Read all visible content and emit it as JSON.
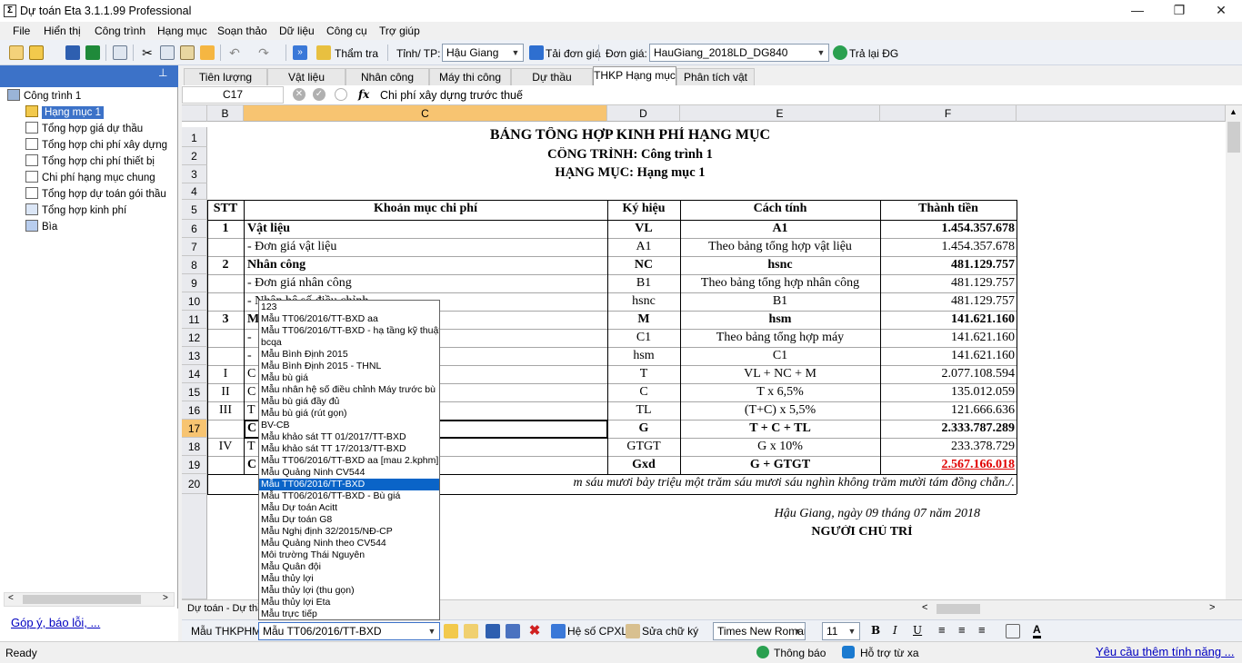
{
  "window": {
    "title": "Dự toán Eta 3.1.1.99 Professional",
    "app_icon": "sigma-icon"
  },
  "menu": [
    "File",
    "Hiển thị",
    "Công trình",
    "Hạng mục",
    "Soạn thảo",
    "Dữ liệu",
    "Công cụ",
    "Trợ giúp"
  ],
  "toolbar": {
    "tham_tra": "Thẩm tra",
    "tinh_tp_label": "Tỉnh/ TP:",
    "tinh_tp_value": "Hậu Giang",
    "tai_don_gia": "Tải đơn giá",
    "don_gia_label": "Đơn giá:",
    "don_gia_value": "HauGiang_2018LD_DG840",
    "tra_lai_dg": "Trả lại ĐG"
  },
  "tree": {
    "root": "Công trình 1",
    "items": [
      "Hạng mục 1",
      "Tổng hợp giá dự thầu",
      "Tổng hợp chi phí xây dựng",
      "Tổng hợp chi phí thiết bị",
      "Chi phí hạng mục chung",
      "Tổng hợp dự toán gói thầu",
      "Tổng hợp kinh phí",
      "Bìa"
    ],
    "feedback": "Góp ý, báo lỗi, ..."
  },
  "tabs": [
    "Tiên lượng",
    "Vật liệu",
    "Nhân công",
    "Máy thi công",
    "Dự thầu",
    "THKP Hạng mục",
    "Phân tích vật tư"
  ],
  "active_tab": "THKP Hạng mục",
  "formula": {
    "cell_ref": "C17",
    "fx": "fx",
    "content": "Chi phí xây dựng trước thuế"
  },
  "columns": [
    "B",
    "C",
    "D",
    "E",
    "F"
  ],
  "rows": [
    "1",
    "2",
    "3",
    "4",
    "5",
    "6",
    "7",
    "8",
    "9",
    "10",
    "11",
    "12",
    "13",
    "14",
    "15",
    "16",
    "17",
    "18",
    "19",
    "20"
  ],
  "sheet": {
    "title": "BẢNG TỔNG HỢP KINH PHÍ HẠNG MỤC",
    "line2": "CÔNG TRÌNH: Công trình 1",
    "line3": "HẠNG MỤC: Hạng mục 1",
    "headers": [
      "STT",
      "Khoản mục chi phí",
      "Ký hiệu",
      "Cách tính",
      "Thành tiền"
    ],
    "body": [
      {
        "stt": "1",
        "name": "Vật liệu",
        "sym": "VL",
        "calc": "A1",
        "amt": "1.454.357.678",
        "bold": true
      },
      {
        "stt": "",
        "name": "- Đơn giá vật liệu",
        "sym": "A1",
        "calc": "Theo bảng tổng hợp vật liệu",
        "amt": "1.454.357.678",
        "bold": false
      },
      {
        "stt": "2",
        "name": "Nhân công",
        "sym": "NC",
        "calc": "hsnc",
        "amt": "481.129.757",
        "bold": true
      },
      {
        "stt": "",
        "name": "- Đơn giá nhân công",
        "sym": "B1",
        "calc": "Theo bảng tổng hợp nhân công",
        "amt": "481.129.757",
        "bold": false
      },
      {
        "stt": "",
        "name": "- Nhân hệ số điều chỉnh",
        "sym": "hsnc",
        "calc": "B1",
        "amt": "481.129.757",
        "bold": false
      },
      {
        "stt": "3",
        "name": "M",
        "sym": "M",
        "calc": "hsm",
        "amt": "141.621.160",
        "bold": true
      },
      {
        "stt": "",
        "name": "-",
        "sym": "C1",
        "calc": "Theo bảng tổng hợp máy",
        "amt": "141.621.160",
        "bold": false
      },
      {
        "stt": "",
        "name": "-",
        "sym": "hsm",
        "calc": "C1",
        "amt": "141.621.160",
        "bold": false
      },
      {
        "stt": "I",
        "name": "C",
        "sym": "T",
        "calc": "VL + NC + M",
        "amt": "2.077.108.594",
        "bold": false
      },
      {
        "stt": "II",
        "name": "C",
        "sym": "C",
        "calc": "T x 6,5%",
        "amt": "135.012.059",
        "bold": false
      },
      {
        "stt": "III",
        "name": "T                                    RƯỚC",
        "sym": "TL",
        "calc": "(T+C) x 5,5%",
        "amt": "121.666.636",
        "bold": false
      },
      {
        "stt": "",
        "name": "C",
        "sym": "G",
        "calc": "T + C + TL",
        "amt": "2.333.787.289",
        "bold": true
      },
      {
        "stt": "IV",
        "name": "T",
        "sym": "GTGT",
        "calc": "G x 10%",
        "amt": "233.378.729",
        "bold": false
      },
      {
        "stt": "",
        "name": "C",
        "sym": "Gxd",
        "calc": "G + GTGT",
        "amt": "2.567.166.018",
        "bold": true,
        "red": true
      }
    ],
    "row20": "m sáu mươi bảy triệu một trăm sáu mươi sáu nghìn không trăm mười tám đồng chẵn./.",
    "place_date": "Hậu Giang, ngày 09 tháng 07 năm 2018",
    "signer": "NGƯỜI CHỦ TRÌ"
  },
  "dropdown": {
    "options": [
      "123",
      "Mẫu TT06/2016/TT-BXD aa",
      "Mẫu TT06/2016/TT-BXD - hạ tầng kỹ thuật",
      "bcqa",
      "Mẫu Bình Định 2015",
      "Mẫu Bình Định 2015 - THNL",
      "Mẫu bù giá",
      "Mẫu nhân hệ số điều chỉnh Máy trước bù",
      "Mẫu bù giá đầy đủ",
      "Mẫu bù giá (rút gọn)",
      "BV-CB",
      "Mẫu khảo sát TT 01/2017/TT-BXD",
      "Mẫu khảo sát TT 17/2013/TT-BXD",
      "Mẫu TT06/2016/TT-BXD aa [mau 2.kphm]",
      "Mẫu Quảng Ninh CV544",
      "Mẫu TT06/2016/TT-BXD",
      "Mẫu TT06/2016/TT-BXD - Bù giá",
      "Mẫu Dự toán Acitt",
      "Mẫu Dự toán G8",
      "Mẫu Nghị định 32/2015/NĐ-CP",
      "Mẫu Quảng Ninh theo CV544",
      "Môi trường Thái Nguyên",
      "Mẫu Quân đội",
      "Mẫu thủy lợi",
      "Mẫu thủy lợi (thu gọn)",
      "Mẫu thủy lợi Eta",
      "Mẫu trực tiếp"
    ],
    "selected_index": 15
  },
  "bottom": {
    "sheet_tab": "Dự toán - Dự thầ",
    "mau_label": "Mẫu THKPHM:",
    "mau_value": "Mẫu TT06/2016/TT-BXD",
    "he_so": "Hệ số CPXL",
    "sua_chu_ky": "Sửa chữ ký",
    "font": "Times New Roman",
    "size": "11"
  },
  "status": {
    "ready": "Ready",
    "thong_bao": "Thông báo",
    "ho_tro": "Hỗ trợ từ xa",
    "yeu_cau": "Yêu cầu thêm tính năng ..."
  }
}
